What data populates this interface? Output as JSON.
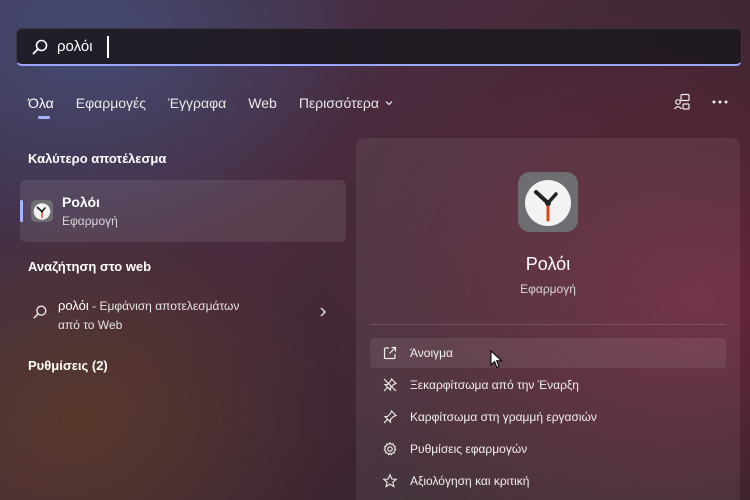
{
  "search": {
    "value": "ρολόι",
    "placeholder": ""
  },
  "tabs": [
    {
      "label": "Όλα"
    },
    {
      "label": "Εφαρμογές"
    },
    {
      "label": "Έγγραφα"
    },
    {
      "label": "Web"
    },
    {
      "label": "Περισσότερα"
    }
  ],
  "sections": {
    "best_match": "Καλύτερο αποτέλεσμα",
    "web_search": "Αναζήτηση στο web",
    "settings": "Ρυθμίσεις (2)"
  },
  "best_result": {
    "title": "Ρολόι",
    "subtitle": "Εφαρμογή"
  },
  "web_result": {
    "query": "ρολόι",
    "line1": " - Εμφάνιση αποτελεσμάτων",
    "line2": "από το Web"
  },
  "preview": {
    "app_name": "Ρολόι",
    "app_type": "Εφαρμογή",
    "actions": [
      {
        "label": "Άνοιγμα",
        "icon": "open-external-icon"
      },
      {
        "label": "Ξεκαρφίτσωμα από την Έναρξη",
        "icon": "unpin-icon"
      },
      {
        "label": "Καρφίτσωμα στη γραμμή εργασιών",
        "icon": "pin-icon"
      },
      {
        "label": "Ρυθμίσεις εφαρμογών",
        "icon": "gear-icon"
      },
      {
        "label": "Αξιολόγηση και κριτική",
        "icon": "star-icon"
      }
    ]
  },
  "colors": {
    "accent": "#a6b4ff",
    "panel": "#ffffff12"
  }
}
